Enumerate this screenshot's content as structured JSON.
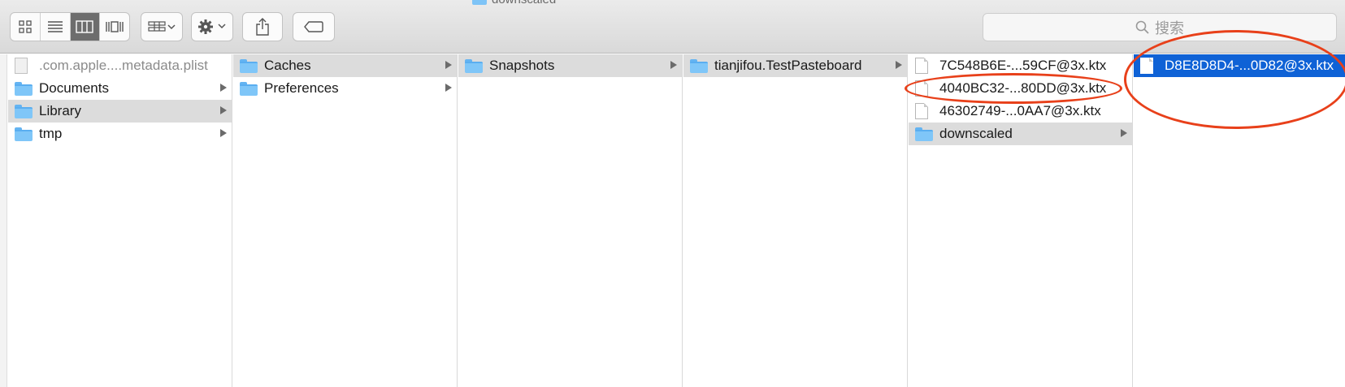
{
  "window": {
    "title": "downscaled"
  },
  "toolbar": {
    "view_buttons": [
      {
        "name": "icon-view-button",
        "icon": "grid-icon"
      },
      {
        "name": "list-view-button",
        "icon": "list-icon"
      },
      {
        "name": "column-view-button",
        "icon": "columns-icon",
        "active": true
      },
      {
        "name": "cover-flow-button",
        "icon": "coverflow-icon"
      }
    ],
    "group_button_icon": "group-grid-icon",
    "action_button_icon": "gear-icon",
    "share_button_icon": "share-icon",
    "tag_button_icon": "tag-icon",
    "search": {
      "placeholder": "搜索",
      "icon": "search-icon"
    }
  },
  "columns": [
    {
      "items": [
        {
          "label": ".com.apple....metadata.plist",
          "kind": "plist",
          "dim": true
        },
        {
          "label": "Documents",
          "kind": "folder",
          "arrow": true
        },
        {
          "label": "Library",
          "kind": "folder",
          "arrow": true,
          "highlight": true
        },
        {
          "label": "tmp",
          "kind": "folder",
          "arrow": true
        }
      ]
    },
    {
      "items": [
        {
          "label": "Caches",
          "kind": "folder",
          "arrow": true,
          "highlight": true
        },
        {
          "label": "Preferences",
          "kind": "folder",
          "arrow": true
        }
      ]
    },
    {
      "items": [
        {
          "label": "Snapshots",
          "kind": "folder",
          "arrow": true,
          "highlight": true
        }
      ]
    },
    {
      "items": [
        {
          "label": "tianjifou.TestPasteboard",
          "kind": "folder",
          "arrow": true,
          "highlight": true
        }
      ]
    },
    {
      "items": [
        {
          "label": "7C548B6E-...59CF@3x.ktx",
          "kind": "file"
        },
        {
          "label": "4040BC32-...80DD@3x.ktx",
          "kind": "file",
          "annotated": true
        },
        {
          "label": "46302749-...0AA7@3x.ktx",
          "kind": "file"
        },
        {
          "label": "downscaled",
          "kind": "folder",
          "arrow": true,
          "highlight": true
        }
      ]
    },
    {
      "items": [
        {
          "label": "D8E8D8D4-...0D82@3x.ktx",
          "kind": "file",
          "selected": true,
          "annotated": true
        }
      ]
    }
  ],
  "colors": {
    "selection": "#0f62d6",
    "folder": "#7fc6f8",
    "annotation": "#e8401a",
    "highlight": "#dcdcdc"
  }
}
